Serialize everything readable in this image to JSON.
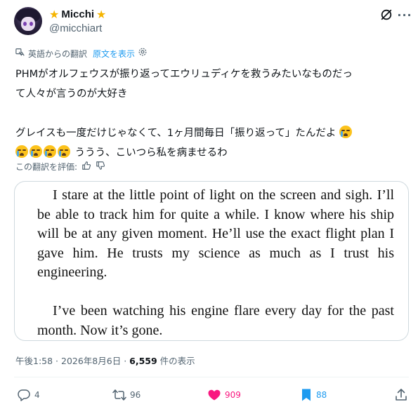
{
  "author": {
    "display_name": "Micchi",
    "handle": "@micchiart",
    "name_decoration": "star-icon"
  },
  "translation": {
    "label": "英語からの翻訳",
    "show_original": "原文を表示"
  },
  "tweet": {
    "line1": "PHMがオルフェウスが振り返ってエウリュディケを救うみたいなものだっ",
    "line2": "て人々が言うのが大好き",
    "line3": "グレイスも一度だけじゃなくて、1ヶ月間毎日「振り返って」たんだよ",
    "line4_after_emoji": " ううう、こいつら私を病ませるわ",
    "emoji": "loudly-crying-face"
  },
  "rate": {
    "label": "この翻訳を評価:"
  },
  "quoted_image": {
    "paragraph1": "I stare at the little point of light on the screen and sigh. I’ll be able to track him for quite a while. I know where his ship will be at any given moment. He’ll use the exact flight plan I gave him. He trusts my science as much as I trust his engineering.",
    "paragraph2": "I’ve been watching his engine flare every day for the past month. Now it’s gone."
  },
  "meta": {
    "time": "午後1:58",
    "sep1": " · ",
    "date": "2026年8月6日",
    "sep2": " · ",
    "views": "6,559",
    "views_label": " 件の表示"
  },
  "actions": {
    "replies": "4",
    "retweets": "96",
    "likes": "909",
    "bookmarks": "88"
  },
  "colors": {
    "accent": "#1d9bf0",
    "like": "#f91880",
    "muted": "#536471",
    "star": "#f5b400"
  }
}
